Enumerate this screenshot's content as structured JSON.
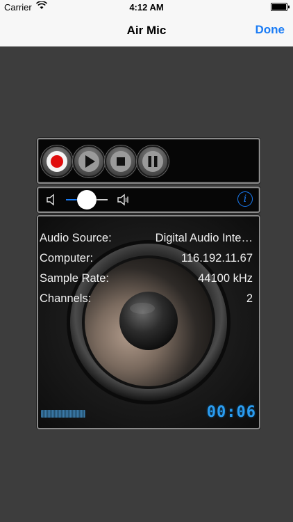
{
  "status": {
    "carrier": "Carrier",
    "time": "4:12 AM"
  },
  "nav": {
    "title": "Air Mic",
    "done_label": "Done"
  },
  "accent_color": "#1a7cf5",
  "transport": {
    "buttons": [
      {
        "name": "record",
        "icon": "record-icon"
      },
      {
        "name": "play",
        "icon": "play-icon"
      },
      {
        "name": "stop",
        "icon": "stop-icon"
      },
      {
        "name": "pause",
        "icon": "pause-icon"
      }
    ]
  },
  "volume": {
    "level": 0.5,
    "low_icon": "speaker-low-icon",
    "high_icon": "speaker-high-icon",
    "info_glyph": "i"
  },
  "details": [
    {
      "key": "Audio Source:",
      "value": "Digital Audio Inte…"
    },
    {
      "key": "Computer:",
      "value": "116.192.11.67"
    },
    {
      "key": "Sample Rate:",
      "value": "44100 kHz"
    },
    {
      "key": "Channels:",
      "value": "2"
    }
  ],
  "timer": "00:06"
}
